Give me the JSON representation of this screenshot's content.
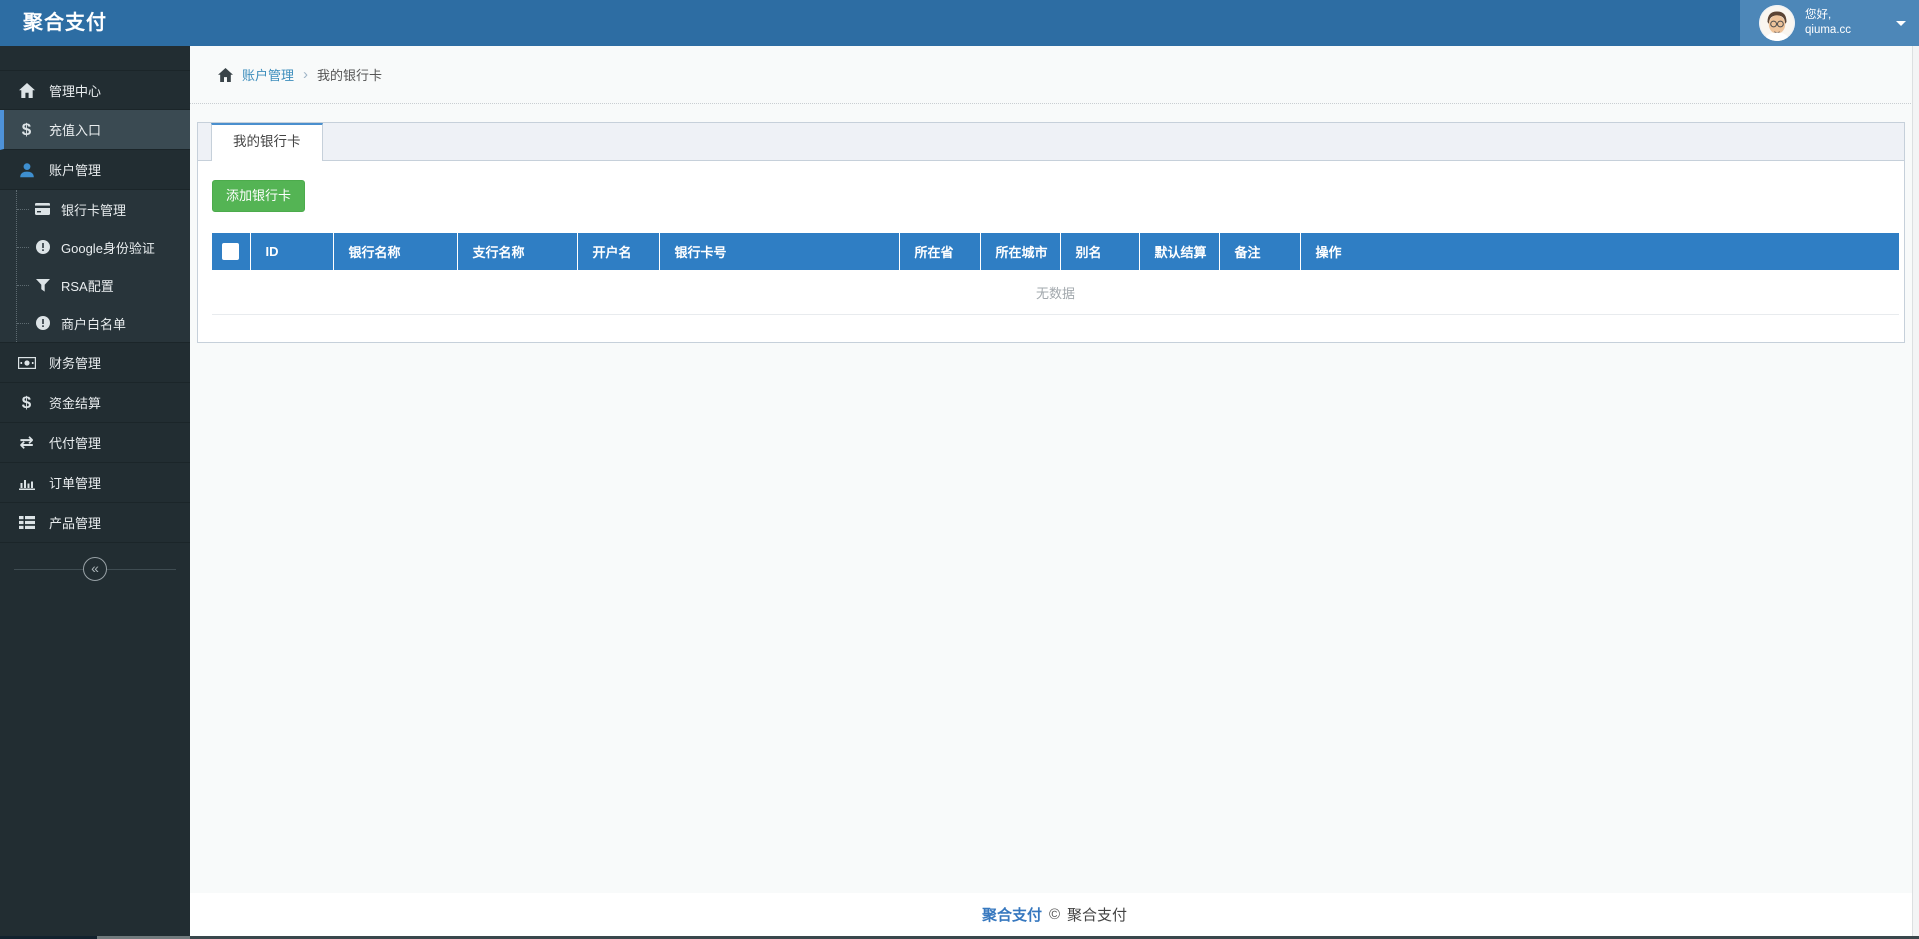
{
  "app": {
    "title": "聚合支付"
  },
  "topbar": {
    "greeting_line1": "您好,",
    "greeting_line2": "qiuma.cc"
  },
  "sidebar": {
    "items": [
      {
        "label": "管理中心"
      },
      {
        "label": "充值入口"
      },
      {
        "label": "账户管理"
      },
      {
        "label": "财务管理"
      },
      {
        "label": "资金结算"
      },
      {
        "label": "代付管理"
      },
      {
        "label": "订单管理"
      },
      {
        "label": "产品管理"
      }
    ],
    "submenu": [
      {
        "label": "银行卡管理"
      },
      {
        "label": "Google身份验证"
      },
      {
        "label": "RSA配置"
      },
      {
        "label": "商户白名单"
      }
    ],
    "collapse_glyph": "«"
  },
  "icons": {
    "dollar": "$",
    "exchange": "⇄"
  },
  "breadcrumb": {
    "link": "账户管理",
    "separator": "›",
    "current": "我的银行卡"
  },
  "main": {
    "tab_label": "我的银行卡",
    "add_button_label": "添加银行卡",
    "table": {
      "columns": [
        "ID",
        "银行名称",
        "支行名称",
        "开户名",
        "银行卡号",
        "所在省",
        "所在城市",
        "别名",
        "默认结算",
        "备注",
        "操作"
      ],
      "empty_text": "无数据",
      "rows": []
    }
  },
  "footer": {
    "brand_link": "聚合支付",
    "copyright": "©",
    "brand": "聚合支付"
  },
  "colors": {
    "topbar": "#2d6da3",
    "topbar_user_bg": "#4d87b8",
    "sidebar_bg": "#222d32",
    "sidebar_active_border": "#4e92d8",
    "table_header": "#2f7ec4",
    "button_green": "#54b454",
    "link_blue": "#3c8dbc",
    "tab_top_border": "#4a8fce"
  }
}
